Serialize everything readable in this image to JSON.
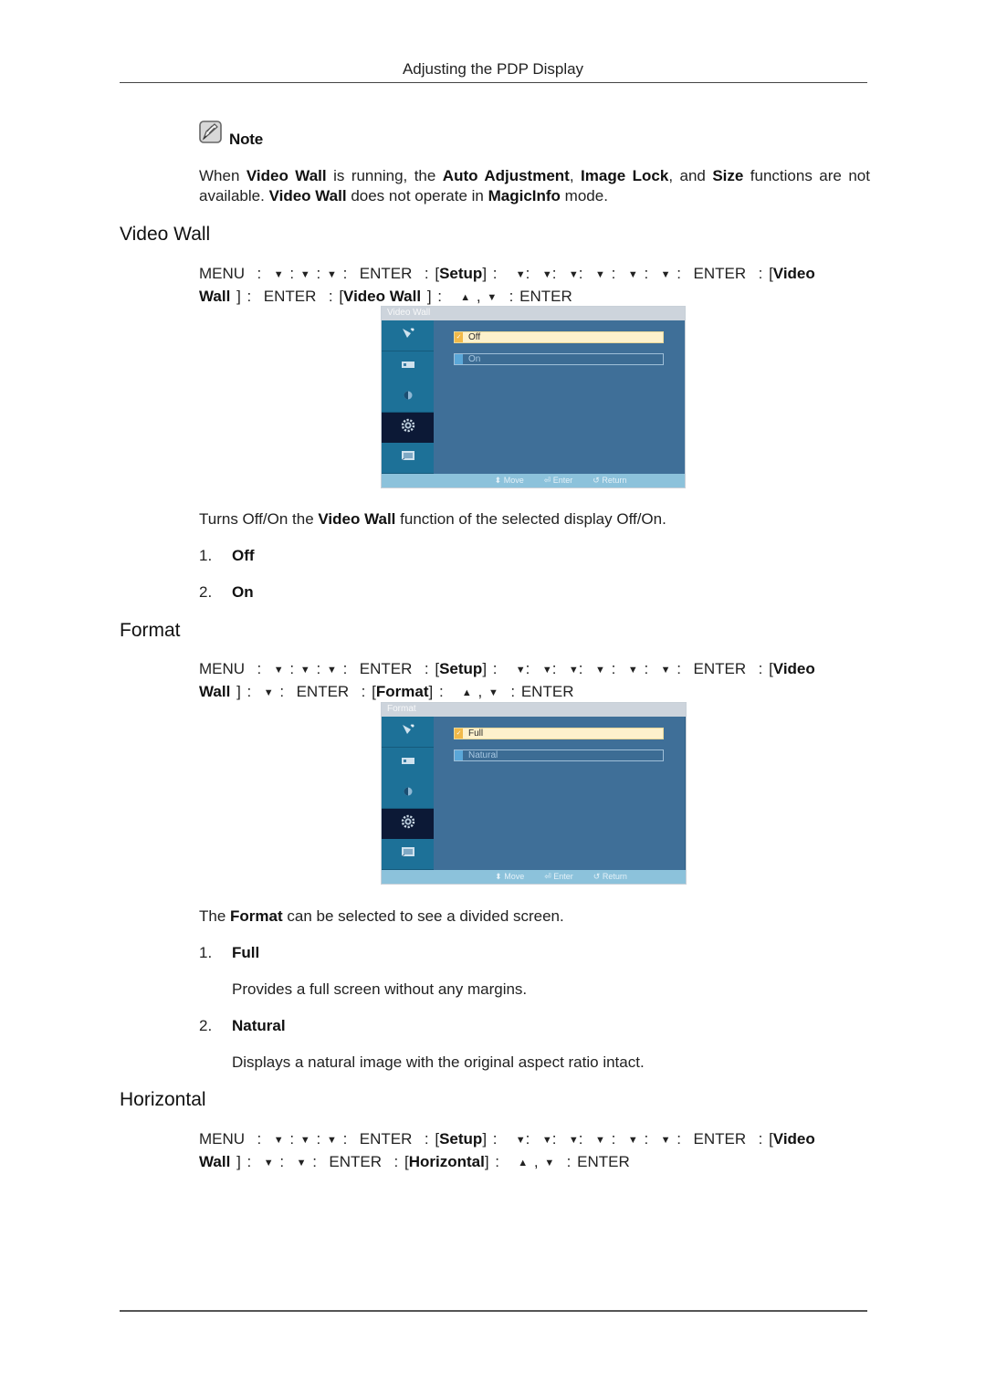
{
  "header": {
    "title": "Adjusting the PDP Display"
  },
  "note": {
    "label": "Note",
    "text_parts": [
      {
        "t": "When ",
        "b": false
      },
      {
        "t": "Video Wall",
        "b": true
      },
      {
        "t": " is running, the ",
        "b": false
      },
      {
        "t": "Auto Adjustment",
        "b": true
      },
      {
        "t": ", ",
        "b": false
      },
      {
        "t": "Image Lock",
        "b": true
      },
      {
        "t": ", and ",
        "b": false
      },
      {
        "t": "Size",
        "b": true
      },
      {
        "t": " functions are not available. ",
        "b": false
      },
      {
        "t": "Video Wall",
        "b": true
      },
      {
        "t": " does not operate in ",
        "b": false
      },
      {
        "t": "MagicInfo",
        "b": true
      },
      {
        "t": " mode.",
        "b": false
      }
    ]
  },
  "sections": {
    "video_wall": {
      "heading": "Video Wall",
      "menu_line1": "MENU  :  ▼ : ▼ : ▼ :  ENTER  : [|Setup|] :   ▼:  ▼:  ▼:  ▼ :  ▼ :  ▼ :  ENTER  : [|Video",
      "menu_line2": "|Wall| ] :  ENTER  : [|Video Wall| ] :   ▲ , ▼  : ENTER",
      "osd": {
        "title": "Video Wall",
        "options": [
          {
            "label": "Off",
            "selected": true
          },
          {
            "label": "On",
            "selected": false
          }
        ],
        "footer": {
          "move": "Move",
          "enter": "Enter",
          "return": "Return"
        }
      },
      "description_parts": [
        {
          "t": "Turns Off/On the ",
          "b": false
        },
        {
          "t": "Video Wall",
          "b": true
        },
        {
          "t": " function of the selected display Off/On.",
          "b": false
        }
      ],
      "items": [
        {
          "num": "1.",
          "label": "Off"
        },
        {
          "num": "2.",
          "label": "On"
        }
      ]
    },
    "format": {
      "heading": "Format",
      "menu_line1": "MENU  :  ▼ : ▼ : ▼ :  ENTER  : [|Setup|] :   ▼:  ▼:  ▼:  ▼ :  ▼ :  ▼ :  ENTER  : [|Video",
      "menu_line2": "|Wall| ] :  ▼ :  ENTER  : [|Format|] :   ▲ , ▼  : ENTER",
      "osd": {
        "title": "Format",
        "options": [
          {
            "label": "Full",
            "selected": true
          },
          {
            "label": "Natural",
            "selected": false
          }
        ],
        "footer": {
          "move": "Move",
          "enter": "Enter",
          "return": "Return"
        }
      },
      "description_parts": [
        {
          "t": "The ",
          "b": false
        },
        {
          "t": "Format",
          "b": true
        },
        {
          "t": " can be selected to see a divided screen.",
          "b": false
        }
      ],
      "items": [
        {
          "num": "1.",
          "label": "Full",
          "desc": "Provides a full screen without any margins."
        },
        {
          "num": "2.",
          "label": "Natural",
          "desc": "Displays a natural image with the original aspect ratio intact."
        }
      ]
    },
    "horizontal": {
      "heading": "Horizontal",
      "menu_line1": "MENU  :  ▼ : ▼ : ▼ :  ENTER  : [|Setup|] :   ▼:  ▼:  ▼:  ▼ :  ▼ :  ▼ :  ENTER  : [|Video",
      "menu_line2": "|Wall| ] :  ▼ :  ▼ :  ENTER  : [|Horizontal|] :   ▲ , ▼  : ENTER"
    }
  },
  "icons": {
    "note": "note-pencil-icon",
    "osd_tabs": [
      "antenna-icon",
      "picture-icon",
      "sound-icon",
      "setup-gear-icon",
      "multi-screen-icon"
    ]
  },
  "colors": {
    "osd_background": "#3f6f98",
    "osd_sidebar": "#1d7198",
    "osd_active_tab": "#0c1936",
    "osd_selected_option": "#fdf1cc",
    "osd_footer": "#8cc2db"
  }
}
